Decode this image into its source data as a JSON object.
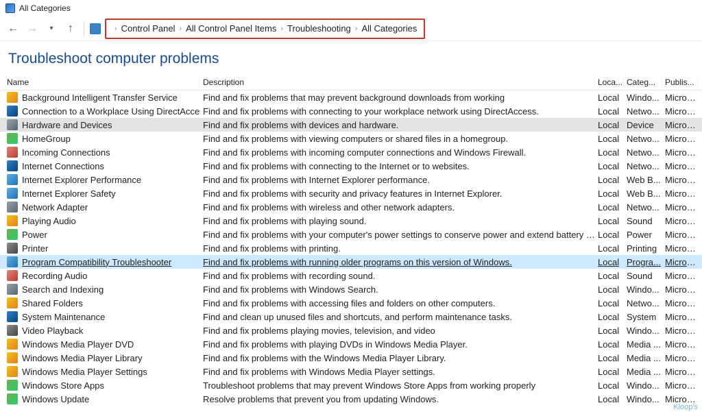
{
  "window": {
    "title": "All Categories"
  },
  "breadcrumb": [
    "Control Panel",
    "All Control Panel Items",
    "Troubleshooting",
    "All Categories"
  ],
  "heading": "Troubleshoot computer problems",
  "columns": {
    "name": "Name",
    "desc": "Description",
    "loc": "Loca...",
    "cat": "Categ...",
    "pub": "Publis..."
  },
  "rows": [
    {
      "ico": "ico-a",
      "name": "Background Intelligent Transfer Service",
      "desc": "Find and fix problems that may prevent background downloads from working",
      "loc": "Local",
      "cat": "Windo...",
      "pub": "Micros..."
    },
    {
      "ico": "ico-b",
      "name": "Connection to a Workplace Using DirectAccess",
      "desc": "Find and fix problems with connecting to your workplace network using DirectAccess.",
      "loc": "Local",
      "cat": "Netwo...",
      "pub": "Micros..."
    },
    {
      "ico": "ico-f",
      "name": "Hardware and Devices",
      "desc": "Find and fix problems with devices and hardware.",
      "loc": "Local",
      "cat": "Device",
      "pub": "Micros...",
      "sel": "gray"
    },
    {
      "ico": "ico-d",
      "name": "HomeGroup",
      "desc": "Find and fix problems with viewing computers or shared files in a homegroup.",
      "loc": "Local",
      "cat": "Netwo...",
      "pub": "Micros..."
    },
    {
      "ico": "ico-e",
      "name": "Incoming Connections",
      "desc": "Find and fix problems with incoming computer connections and Windows Firewall.",
      "loc": "Local",
      "cat": "Netwo...",
      "pub": "Micros..."
    },
    {
      "ico": "ico-b",
      "name": "Internet Connections",
      "desc": "Find and fix problems with connecting to the Internet or to websites.",
      "loc": "Local",
      "cat": "Netwo...",
      "pub": "Micros..."
    },
    {
      "ico": "ico-c",
      "name": "Internet Explorer Performance",
      "desc": "Find and fix problems with Internet Explorer performance.",
      "loc": "Local",
      "cat": "Web B...",
      "pub": "Micros..."
    },
    {
      "ico": "ico-c",
      "name": "Internet Explorer Safety",
      "desc": "Find and fix problems with security and privacy features in Internet Explorer.",
      "loc": "Local",
      "cat": "Web B...",
      "pub": "Micros..."
    },
    {
      "ico": "ico-f",
      "name": "Network Adapter",
      "desc": "Find and fix problems with wireless and other network adapters.",
      "loc": "Local",
      "cat": "Netwo...",
      "pub": "Micros..."
    },
    {
      "ico": "ico-a",
      "name": "Playing Audio",
      "desc": "Find and fix problems with playing sound.",
      "loc": "Local",
      "cat": "Sound",
      "pub": "Micros..."
    },
    {
      "ico": "ico-d",
      "name": "Power",
      "desc": "Find and fix problems with your computer's power settings to conserve power and extend battery life.",
      "loc": "Local",
      "cat": "Power",
      "pub": "Micros..."
    },
    {
      "ico": "ico-g",
      "name": "Printer",
      "desc": "Find and fix problems with printing.",
      "loc": "Local",
      "cat": "Printing",
      "pub": "Micros..."
    },
    {
      "ico": "ico-c",
      "name": "Program Compatibility Troubleshooter",
      "desc": "Find and fix problems with running older programs on this version of Windows.",
      "loc": "Local",
      "cat": "Progra...",
      "pub": "Micros...",
      "sel": "blue"
    },
    {
      "ico": "ico-e",
      "name": "Recording Audio",
      "desc": "Find and fix problems with recording sound.",
      "loc": "Local",
      "cat": "Sound",
      "pub": "Micros..."
    },
    {
      "ico": "ico-f",
      "name": "Search and Indexing",
      "desc": "Find and fix problems with Windows Search.",
      "loc": "Local",
      "cat": "Windo...",
      "pub": "Micros..."
    },
    {
      "ico": "ico-a",
      "name": "Shared Folders",
      "desc": "Find and fix problems with accessing files and folders on other computers.",
      "loc": "Local",
      "cat": "Netwo...",
      "pub": "Micros..."
    },
    {
      "ico": "ico-b",
      "name": "System Maintenance",
      "desc": "Find and clean up unused files and shortcuts, and perform maintenance tasks.",
      "loc": "Local",
      "cat": "System",
      "pub": "Micros..."
    },
    {
      "ico": "ico-g",
      "name": "Video Playback",
      "desc": "Find and fix problems playing movies, television, and video",
      "loc": "Local",
      "cat": "Windo...",
      "pub": "Micros..."
    },
    {
      "ico": "ico-a",
      "name": "Windows Media Player DVD",
      "desc": "Find and fix problems with playing DVDs in Windows Media Player.",
      "loc": "Local",
      "cat": "Media ...",
      "pub": "Micros..."
    },
    {
      "ico": "ico-a",
      "name": "Windows Media Player Library",
      "desc": "Find and fix problems with the Windows Media Player Library.",
      "loc": "Local",
      "cat": "Media ...",
      "pub": "Micros..."
    },
    {
      "ico": "ico-a",
      "name": "Windows Media Player Settings",
      "desc": "Find and fix problems with Windows Media Player settings.",
      "loc": "Local",
      "cat": "Media ...",
      "pub": "Micros..."
    },
    {
      "ico": "ico-d",
      "name": "Windows Store Apps",
      "desc": "Troubleshoot problems that may prevent Windows Store Apps from working properly",
      "loc": "Local",
      "cat": "Windo...",
      "pub": "Micros..."
    },
    {
      "ico": "ico-d",
      "name": "Windows Update",
      "desc": "Resolve problems that prevent you from updating Windows.",
      "loc": "Local",
      "cat": "Windo...",
      "pub": "Micros..."
    }
  ],
  "watermark": "Kloop's"
}
